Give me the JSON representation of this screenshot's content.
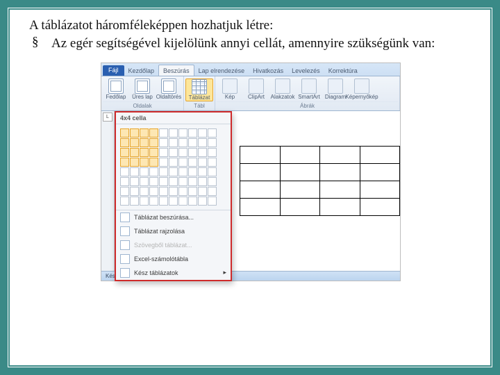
{
  "lead": "A táblázatot háromféleképpen hozhatjuk létre:",
  "bullet_sym": "§",
  "bullet": "Az egér segítségével kijelölünk annyi cellát, amennyire szükségünk van:",
  "tabs": {
    "file": "Fájl",
    "t1": "Kezdőlap",
    "t2": "Beszúrás",
    "t3": "Lap elrendezése",
    "t4": "Hivatkozás",
    "t5": "Levelezés",
    "t6": "Korrektúra"
  },
  "group_pages": {
    "b1": "Fedőlap",
    "b2": "Üres lap",
    "b3": "Oldaltörés",
    "label": "Oldalak"
  },
  "group_table": {
    "b": "Táblázat",
    "label": "Tábl"
  },
  "group_ill": {
    "b1": "Kép",
    "b2": "ClipArt",
    "b3": "Alakzatok",
    "b4": "SmartArt",
    "b5": "Diagram",
    "b6": "Képernyőkép",
    "label": "Ábrák"
  },
  "panel": {
    "header": "4x4 cella",
    "sel_cols": 4,
    "sel_rows": 4,
    "m1": "Táblázat beszúrása...",
    "m2": "Táblázat rajzolása",
    "m3": "Szövegből táblázat...",
    "m4": "Excel-számolótábla",
    "m5": "Kész táblázatok"
  },
  "status": "Kész",
  "rulemark": "L"
}
